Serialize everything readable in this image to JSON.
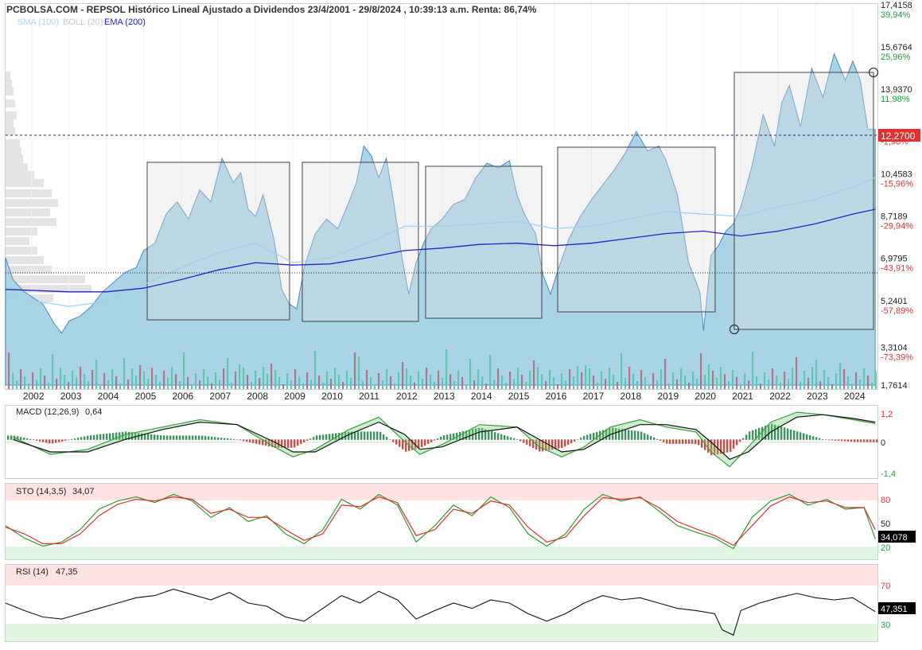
{
  "header": {
    "title": "PCBOLSA.COM - REPSOL Histórico Lineal Ajustado a Dividendos 23/4/2001 - 29/8/2024 , 10:39:13 a.m. Renta: 86,74%",
    "legend": [
      {
        "label": "SMA (100)",
        "color": "#a9d6f0"
      },
      {
        "label": "BOLL (20)",
        "color": "#d3d3d3"
      },
      {
        "label": "EMA (200)",
        "color": "#1f1fc8"
      }
    ]
  },
  "colors": {
    "area_fill": "#a8d4e6",
    "area_line": "#4f86c6",
    "sma": "#9fd0ee",
    "ema": "#2323c8",
    "volume_teal": "#5fc7b0",
    "volume_mauve": "#a87a8c",
    "macd_pos": "#2e9e55",
    "macd_neg": "#e4443c",
    "overbought_band": "#ffe3e3",
    "oversold_band": "#e2f7e2",
    "positive_text": "#1e9e3c",
    "negative_text": "#e03030"
  },
  "chart_data": [
    {
      "type": "area",
      "title": "PCBOLSA.COM - REPSOL Histórico Lineal Ajustado a Dividendos 23/4/2001 - 29/8/2024 , 10:39:13 a.m. Renta: 86,74%",
      "x_ticks": [
        "2002",
        "2003",
        "2004",
        "2005",
        "2006",
        "2007",
        "2008",
        "2009",
        "2010",
        "2011",
        "2012",
        "2013",
        "2014",
        "2015",
        "2016",
        "2017",
        "2018",
        "2019",
        "2020",
        "2021",
        "2022",
        "2023",
        "2024"
      ],
      "y_ticks": [
        {
          "value": "17,4158",
          "pct": "39,94%"
        },
        {
          "value": "15,6764",
          "pct": "25,96%"
        },
        {
          "value": "13,9370",
          "pct": "11,98%"
        },
        {
          "value": "12,1976",
          "pct": "-1,98%"
        },
        {
          "value": "10,4583",
          "pct": "-15,96%"
        },
        {
          "value": "8,7189",
          "pct": "-29,94%"
        },
        {
          "value": "6,9795",
          "pct": "-43,91%"
        },
        {
          "value": "5,2401",
          "pct": "-57,89%"
        },
        {
          "value": "3,3104",
          "pct": "-73,39%"
        },
        {
          "value": "1,7614",
          "pct": ""
        }
      ],
      "last_price": "12,2700",
      "ylim": [
        1.7614,
        17.4158
      ],
      "series": [
        {
          "name": "Precio",
          "x": [
            2001.3,
            2001.5,
            2001.8,
            2002.0,
            2002.3,
            2002.6,
            2002.8,
            2003.0,
            2003.3,
            2003.6,
            2003.9,
            2004.2,
            2004.5,
            2004.8,
            2005.0,
            2005.3,
            2005.6,
            2005.9,
            2006.2,
            2006.5,
            2006.8,
            2007.1,
            2007.4,
            2007.6,
            2007.8,
            2008.0,
            2008.2,
            2008.5,
            2008.7,
            2008.9,
            2009.1,
            2009.3,
            2009.6,
            2009.9,
            2010.2,
            2010.5,
            2010.7,
            2010.9,
            2011.1,
            2011.3,
            2011.5,
            2011.7,
            2011.9,
            2012.1,
            2012.3,
            2012.5,
            2012.7,
            2013.0,
            2013.3,
            2013.6,
            2013.9,
            2014.2,
            2014.5,
            2014.8,
            2015.0,
            2015.2,
            2015.5,
            2015.7,
            2015.9,
            2016.1,
            2016.4,
            2016.7,
            2017.0,
            2017.3,
            2017.6,
            2017.9,
            2018.2,
            2018.5,
            2018.8,
            2019.0,
            2019.3,
            2019.6,
            2019.9,
            2020.0,
            2020.2,
            2020.4,
            2020.6,
            2020.8,
            2021.0,
            2021.3,
            2021.6,
            2021.9,
            2022.1,
            2022.3,
            2022.6,
            2022.9,
            2023.2,
            2023.5,
            2023.8,
            2024.0,
            2024.2,
            2024.4,
            2024.6
          ],
          "values": [
            7.0,
            6.1,
            5.6,
            5.4,
            5.1,
            4.3,
            3.9,
            4.4,
            4.6,
            5.0,
            5.6,
            6.0,
            6.4,
            6.6,
            7.3,
            7.6,
            8.8,
            9.3,
            8.6,
            9.8,
            9.3,
            11.1,
            10.1,
            10.5,
            9.0,
            8.7,
            9.6,
            7.7,
            5.7,
            5.1,
            4.9,
            6.6,
            8.0,
            8.6,
            8.2,
            9.3,
            10.1,
            11.6,
            11.2,
            10.3,
            11.1,
            9.3,
            7.2,
            5.5,
            6.8,
            7.6,
            8.2,
            8.6,
            9.2,
            9.4,
            10.3,
            10.9,
            10.7,
            11.0,
            9.6,
            8.8,
            8.0,
            6.3,
            5.5,
            6.5,
            7.8,
            8.7,
            9.4,
            10.0,
            10.6,
            11.3,
            12.2,
            11.4,
            11.6,
            11.0,
            9.6,
            6.8,
            5.6,
            4.0,
            7.1,
            7.5,
            8.1,
            8.4,
            9.1,
            10.8,
            12.9,
            11.6,
            13.4,
            14.1,
            12.4,
            14.8,
            13.6,
            15.4,
            14.3,
            15.1,
            14.3,
            12.3,
            12.27
          ]
        },
        {
          "name": "SMA (100)",
          "x": [
            2001.3,
            2003.0,
            2004.0,
            2005.0,
            2006.0,
            2007.0,
            2008.0,
            2009.0,
            2010.0,
            2011.0,
            2012.0,
            2013.0,
            2014.0,
            2015.0,
            2016.0,
            2017.0,
            2018.0,
            2019.0,
            2020.0,
            2021.0,
            2022.0,
            2023.0,
            2024.0,
            2024.6
          ],
          "values": [
            5.4,
            5.0,
            5.2,
            5.9,
            6.6,
            7.2,
            7.6,
            6.8,
            7.0,
            7.6,
            8.3,
            8.3,
            8.4,
            8.5,
            8.2,
            8.3,
            8.6,
            8.9,
            8.8,
            8.7,
            9.1,
            9.4,
            9.9,
            10.3
          ]
        },
        {
          "name": "EMA (200)",
          "x": [
            2001.3,
            2003.0,
            2004.0,
            2005.0,
            2006.0,
            2007.0,
            2008.0,
            2009.0,
            2010.0,
            2011.0,
            2012.0,
            2013.0,
            2014.0,
            2015.0,
            2016.0,
            2017.0,
            2018.0,
            2019.0,
            2020.0,
            2021.0,
            2022.0,
            2023.0,
            2024.0,
            2024.6
          ],
          "values": [
            5.7,
            5.6,
            5.6,
            5.75,
            6.1,
            6.5,
            6.8,
            6.7,
            6.75,
            7.0,
            7.3,
            7.4,
            7.55,
            7.6,
            7.5,
            7.6,
            7.8,
            8.0,
            8.1,
            7.9,
            8.1,
            8.4,
            8.8,
            9.0
          ]
        }
      ]
    },
    {
      "type": "bar",
      "title": "MACD (12,26,9)",
      "current": "0,64",
      "y_ticks": [
        "1,2",
        "0",
        "-1,4"
      ],
      "ylim": [
        -1.4,
        1.2
      ],
      "x": [
        2001.5,
        2002.5,
        2003.5,
        2004.5,
        2005.5,
        2006.5,
        2007.5,
        2008.5,
        2009.0,
        2009.6,
        2010.5,
        2011.3,
        2012.0,
        2012.4,
        2013.0,
        2014.0,
        2015.0,
        2015.6,
        2016.2,
        2016.8,
        2017.5,
        2018.3,
        2019.0,
        2019.8,
        2020.2,
        2020.7,
        2021.2,
        2021.8,
        2022.5,
        2023.2,
        2024.0,
        2024.6
      ],
      "values": [
        0.1,
        -0.6,
        -0.4,
        0.2,
        0.5,
        0.8,
        0.6,
        -0.3,
        -0.7,
        -0.4,
        0.4,
        0.9,
        -0.1,
        -0.6,
        -0.2,
        0.6,
        0.5,
        -0.3,
        -0.7,
        -0.3,
        0.5,
        0.8,
        0.5,
        0.3,
        -0.5,
        -1.1,
        -0.3,
        0.7,
        1.1,
        1.0,
        0.8,
        0.64
      ],
      "signal": [
        0.0,
        -0.5,
        -0.5,
        0.0,
        0.4,
        0.7,
        0.6,
        -0.1,
        -0.5,
        -0.5,
        0.2,
        0.7,
        0.2,
        -0.4,
        -0.3,
        0.3,
        0.5,
        0.0,
        -0.5,
        -0.4,
        0.2,
        0.6,
        0.6,
        0.4,
        -0.1,
        -0.8,
        -0.5,
        0.3,
        0.9,
        1.0,
        0.85,
        0.7
      ]
    },
    {
      "type": "line",
      "title": "STO (14,3,5)",
      "current": "34,07",
      "last_label": "34,078",
      "y_ticks": [
        "80",
        "50",
        "20"
      ],
      "ylim": [
        10,
        100
      ],
      "x": [
        2001.3,
        2001.8,
        2002.3,
        2002.8,
        2003.3,
        2003.8,
        2004.3,
        2004.8,
        2005.3,
        2005.8,
        2006.3,
        2006.8,
        2007.3,
        2007.8,
        2008.3,
        2008.8,
        2009.3,
        2009.8,
        2010.3,
        2010.8,
        2011.3,
        2011.8,
        2012.3,
        2012.8,
        2013.3,
        2013.8,
        2014.3,
        2014.8,
        2015.3,
        2015.8,
        2016.3,
        2016.8,
        2017.3,
        2017.8,
        2018.3,
        2018.8,
        2019.3,
        2019.8,
        2020.3,
        2020.8,
        2021.3,
        2021.8,
        2022.3,
        2022.8,
        2023.3,
        2023.8,
        2024.3,
        2024.6
      ],
      "values": [
        50,
        35,
        25,
        30,
        45,
        70,
        80,
        85,
        78,
        88,
        80,
        60,
        72,
        55,
        62,
        40,
        28,
        45,
        82,
        70,
        88,
        75,
        30,
        50,
        75,
        62,
        85,
        72,
        40,
        25,
        40,
        70,
        88,
        80,
        85,
        68,
        50,
        42,
        35,
        22,
        60,
        80,
        88,
        75,
        82,
        70,
        72,
        34
      ],
      "signal": [
        48,
        40,
        28,
        28,
        40,
        62,
        76,
        82,
        80,
        85,
        82,
        65,
        70,
        60,
        60,
        45,
        32,
        40,
        75,
        73,
        85,
        78,
        38,
        45,
        70,
        65,
        80,
        75,
        48,
        30,
        36,
        62,
        84,
        82,
        84,
        72,
        55,
        46,
        38,
        26,
        50,
        74,
        85,
        78,
        80,
        72,
        72,
        45
      ]
    },
    {
      "type": "line",
      "title": "RSI (14)",
      "current": "47,35",
      "last_label": "47,351",
      "y_ticks": [
        "70",
        "30"
      ],
      "ylim": [
        20,
        90
      ],
      "x": [
        2001.3,
        2001.8,
        2002.3,
        2002.8,
        2003.3,
        2003.8,
        2004.3,
        2004.8,
        2005.3,
        2005.8,
        2006.3,
        2006.8,
        2007.3,
        2007.8,
        2008.3,
        2008.8,
        2009.3,
        2009.8,
        2010.3,
        2010.8,
        2011.3,
        2011.8,
        2012.3,
        2012.8,
        2013.3,
        2013.8,
        2014.3,
        2014.8,
        2015.3,
        2015.8,
        2016.3,
        2016.8,
        2017.3,
        2017.8,
        2018.3,
        2018.8,
        2019.3,
        2019.8,
        2020.3,
        2020.5,
        2020.8,
        2021.0,
        2021.5,
        2022.0,
        2022.5,
        2023.0,
        2023.5,
        2024.0,
        2024.6
      ],
      "values": [
        55,
        48,
        42,
        40,
        45,
        50,
        55,
        60,
        62,
        68,
        63,
        58,
        65,
        55,
        52,
        42,
        38,
        50,
        62,
        55,
        66,
        58,
        40,
        48,
        55,
        50,
        58,
        55,
        45,
        38,
        45,
        55,
        62,
        58,
        60,
        55,
        50,
        48,
        45,
        30,
        25,
        48,
        55,
        60,
        64,
        60,
        58,
        60,
        47
      ]
    }
  ]
}
